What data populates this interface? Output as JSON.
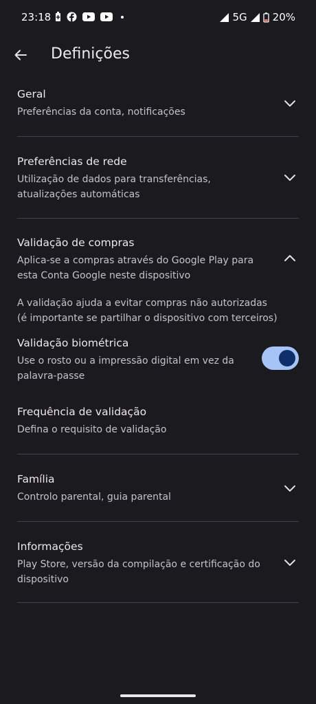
{
  "status_bar": {
    "time": "23:18",
    "network": "5G",
    "battery": "20%",
    "icons": [
      "battery-saver-icon",
      "facebook-icon",
      "youtube-icon",
      "youtube-icon",
      "notification-dot-icon",
      "wifi-signal-icon",
      "cell-signal-icon",
      "battery-icon"
    ]
  },
  "header": {
    "title": "Definições"
  },
  "sections": {
    "geral": {
      "title": "Geral",
      "subtitle": "Preferências da conta, notificações"
    },
    "rede": {
      "title": "Preferências de rede",
      "subtitle": "Utilização de dados para transferências, atualizações automáticas"
    },
    "validacao": {
      "title": "Validação de compras",
      "subtitle": "Aplica-se a compras através do Google Play para esta Conta Google neste dispositivo",
      "info": "A validação ajuda a evitar compras não autorizadas (é importante se partilhar o dispositivo com terceiros)",
      "biometric_title": "Validação biométrica",
      "biometric_subtitle": "Use o rosto ou a impressão digital em vez da palavra-passe",
      "biometric_enabled": true,
      "frequency_title": "Frequência de validação",
      "frequency_subtitle": "Defina o requisito de validação"
    },
    "familia": {
      "title": "Família",
      "subtitle": "Controlo parental, guia parental"
    },
    "informacoes": {
      "title": "Informações",
      "subtitle": "Play Store, versão da compilação e certificação do dispositivo"
    }
  },
  "colors": {
    "background": "#1b1b1f",
    "toggle_track": "#a6c4f5",
    "toggle_knob": "#0f2f6b",
    "divider": "#44424a"
  }
}
